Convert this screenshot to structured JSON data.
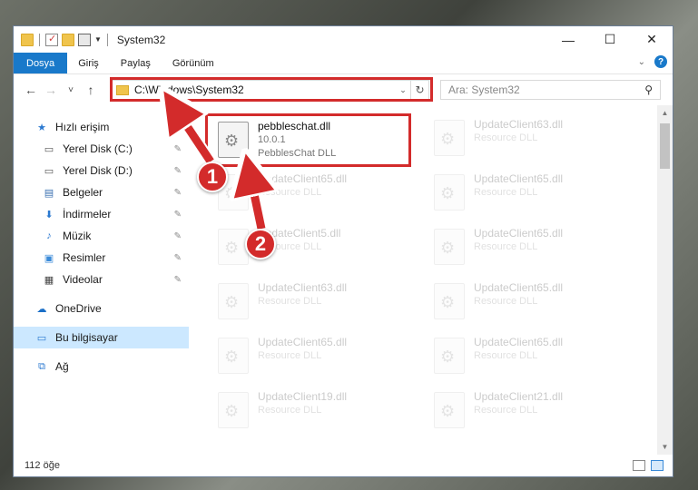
{
  "window": {
    "title": "System32",
    "controls": {
      "minimize": "—",
      "maximize": "☐",
      "close": "✕"
    }
  },
  "ribbon": {
    "tabs": [
      "Dosya",
      "Giriş",
      "Paylaş",
      "Görünüm"
    ],
    "expand_icon": "chevron-down-icon",
    "help": "?"
  },
  "navigation": {
    "back": "←",
    "forward": "→",
    "recent": "˅",
    "up": "↑",
    "address": "C:\\Windows\\System32",
    "refresh": "↻"
  },
  "search": {
    "placeholder": "Ara: System32",
    "icon": "⚲"
  },
  "sidebar": {
    "quick_access": "Hızlı erişim",
    "items": [
      {
        "label": "Yerel Disk (C:)",
        "icon": "drive-icon"
      },
      {
        "label": "Yerel Disk (D:)",
        "icon": "drive-icon"
      },
      {
        "label": "Belgeler",
        "icon": "documents-icon"
      },
      {
        "label": "İndirmeler",
        "icon": "downloads-icon"
      },
      {
        "label": "Müzik",
        "icon": "music-icon"
      },
      {
        "label": "Resimler",
        "icon": "pictures-icon"
      },
      {
        "label": "Videolar",
        "icon": "videos-icon"
      }
    ],
    "onedrive": "OneDrive",
    "this_pc": "Bu bilgisayar",
    "network": "Ağ",
    "pin": "📌"
  },
  "files": [
    {
      "name": "pebbleschat.dll",
      "line2": "10.0.1",
      "line3": "PebblesChat DLL"
    },
    {
      "name": "UpdateClient63.dll",
      "line2": "Resource DLL"
    },
    {
      "name": "UpdateClient65.dll",
      "line2": "Resource DLL"
    },
    {
      "name": "UpdateClient65.dll",
      "line2": "Resource DLL"
    },
    {
      "name": "UpdateClient5.dll",
      "line2": "Resource DLL"
    },
    {
      "name": "UpdateClient65.dll",
      "line2": "Resource DLL"
    },
    {
      "name": "UpdateClient63.dll",
      "line2": "Resource DLL"
    },
    {
      "name": "UpdateClient65.dll",
      "line2": "Resource DLL"
    },
    {
      "name": "UpdateClient65.dll",
      "line2": "Resource DLL"
    },
    {
      "name": "UpdateClient65.dll",
      "line2": "Resource DLL"
    },
    {
      "name": "UpdateClient19.dll",
      "line2": "Resource DLL"
    },
    {
      "name": "UpdateClient21.dll",
      "line2": "Resource DLL"
    }
  ],
  "status": {
    "count": "112 öğe"
  },
  "annotations": {
    "step1": "1",
    "step2": "2",
    "color": "#d32b2b"
  }
}
